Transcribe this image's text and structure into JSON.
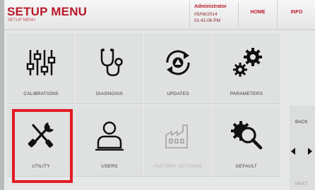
{
  "header": {
    "title": "SETUP MENU",
    "subtitle": "SETUP MENU",
    "user": "Administrator",
    "date": "05/06/2014",
    "time": "01:41:06 PM",
    "home_label": "HOME",
    "info_label": "INFO"
  },
  "tiles": [
    {
      "label": "CALIBRATIONS",
      "icon": "sliders-icon"
    },
    {
      "label": "DIAGNOSIS",
      "icon": "stethoscope-icon"
    },
    {
      "label": "UPDATES",
      "icon": "refresh-icon"
    },
    {
      "label": "PARAMETERS",
      "icon": "gears-icon"
    },
    {
      "label": "UTILITY",
      "icon": "tools-icon"
    },
    {
      "label": "USERS",
      "icon": "user-icon"
    },
    {
      "label": "FACTORY SETTINGS",
      "icon": "factory-icon"
    },
    {
      "label": "DEFAULT",
      "icon": "gear-search-icon"
    }
  ],
  "nav": {
    "back_label": "BACK",
    "next_label": "NEXT"
  },
  "selected_tile": "UTILITY",
  "colors": {
    "accent": "#b9182a",
    "selection": "#e21b24"
  }
}
